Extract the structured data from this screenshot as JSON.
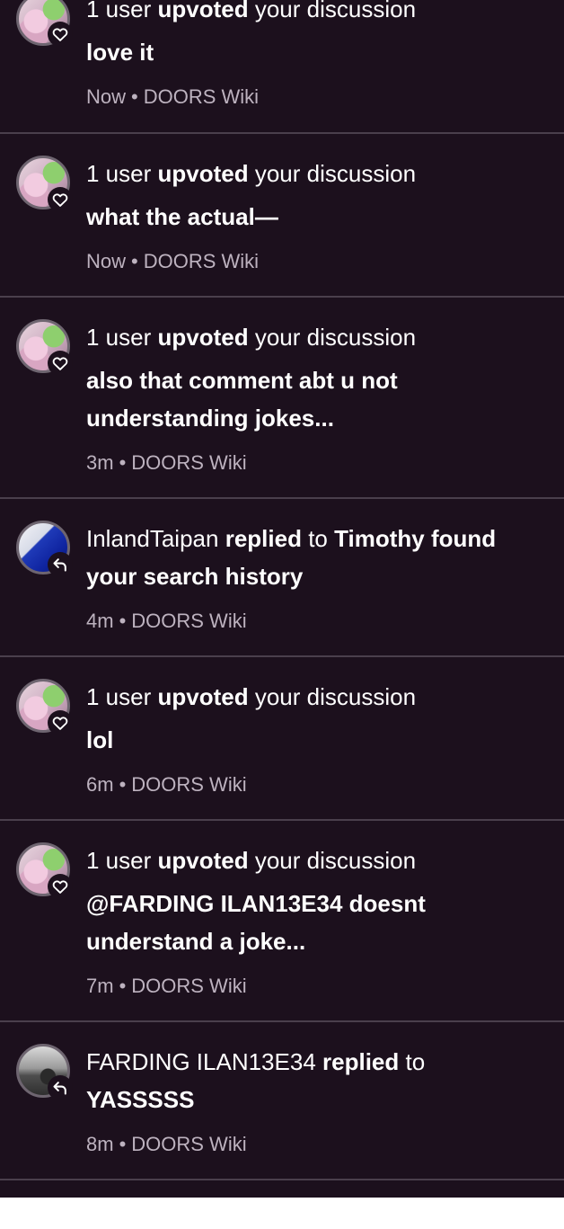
{
  "colors": {
    "background": "#1c101d",
    "divider": "#4a3f4c",
    "primary_text": "#ffffff",
    "secondary_text": "#bdb2bf"
  },
  "meta_separator": "•",
  "notifications": [
    {
      "actor": "1 user",
      "action": "upvoted",
      "connector": "your discussion",
      "message_lines": [
        "love it"
      ],
      "time": "Now",
      "community": "DOORS Wiki",
      "badge_icon": "heart-icon",
      "avatar": "pink-avatar"
    },
    {
      "actor": "1 user",
      "action": "upvoted",
      "connector": "your discussion",
      "message_lines": [
        "what the actual—"
      ],
      "time": "Now",
      "community": "DOORS Wiki",
      "badge_icon": "heart-icon",
      "avatar": "pink-avatar"
    },
    {
      "actor": "1 user",
      "action": "upvoted",
      "connector": "your discussion",
      "message_lines": [
        "also that comment abt u not",
        "understanding jokes..."
      ],
      "time": "3m",
      "community": "DOORS Wiki",
      "badge_icon": "heart-icon",
      "avatar": "pink-avatar"
    },
    {
      "actor": "InlandTaipan",
      "action": "replied",
      "connector": "to",
      "inline_target": "Timothy found",
      "message_lines": [
        "your search history"
      ],
      "time": "4m",
      "community": "DOORS Wiki",
      "badge_icon": "reply-arrow-icon",
      "avatar": "blue-avatar"
    },
    {
      "actor": "1 user",
      "action": "upvoted",
      "connector": "your discussion",
      "message_lines": [
        "lol"
      ],
      "time": "6m",
      "community": "DOORS Wiki",
      "badge_icon": "heart-icon",
      "avatar": "pink-avatar"
    },
    {
      "actor": "1 user",
      "action": "upvoted",
      "connector": "your discussion",
      "message_lines": [
        "@FARDING ILAN13E34 doesnt",
        "understand a joke..."
      ],
      "time": "7m",
      "community": "DOORS Wiki",
      "badge_icon": "heart-icon",
      "avatar": "pink-avatar"
    },
    {
      "actor": "FARDING ILAN13E34",
      "action": "replied",
      "connector": "to",
      "message_lines": [
        "YASSSSS"
      ],
      "time": "8m",
      "community": "DOORS Wiki",
      "badge_icon": "reply-arrow-icon",
      "avatar": "gray-avatar"
    }
  ]
}
